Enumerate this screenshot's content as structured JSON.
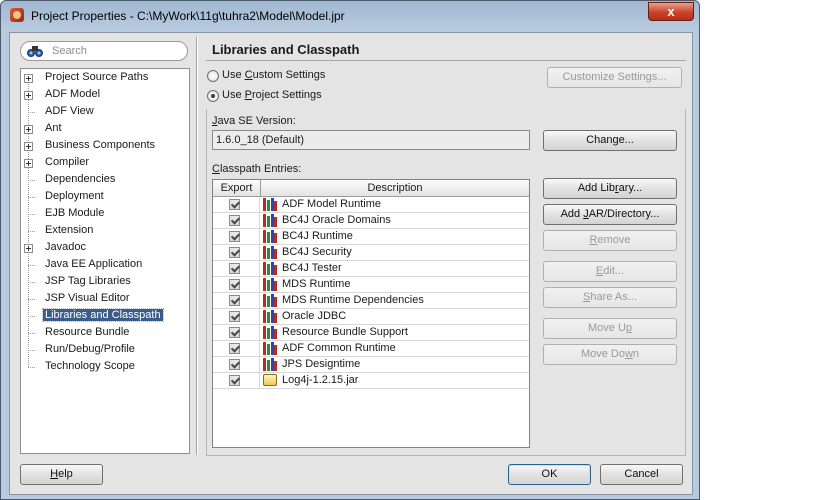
{
  "window": {
    "title": "Project Properties - C:\\MyWork\\11g\\tuhra2\\Model\\Model.jpr",
    "close_label": "x"
  },
  "search": {
    "placeholder": "Search"
  },
  "nav": {
    "items": [
      {
        "label": "Project Source Paths",
        "expandable": true,
        "selected": false
      },
      {
        "label": "ADF Model",
        "expandable": true,
        "selected": false
      },
      {
        "label": "ADF View",
        "expandable": false,
        "selected": false
      },
      {
        "label": "Ant",
        "expandable": true,
        "selected": false
      },
      {
        "label": "Business Components",
        "expandable": true,
        "selected": false
      },
      {
        "label": "Compiler",
        "expandable": true,
        "selected": false
      },
      {
        "label": "Dependencies",
        "expandable": false,
        "selected": false
      },
      {
        "label": "Deployment",
        "expandable": false,
        "selected": false
      },
      {
        "label": "EJB Module",
        "expandable": false,
        "selected": false
      },
      {
        "label": "Extension",
        "expandable": false,
        "selected": false
      },
      {
        "label": "Javadoc",
        "expandable": true,
        "selected": false
      },
      {
        "label": "Java EE Application",
        "expandable": false,
        "selected": false
      },
      {
        "label": "JSP Tag Libraries",
        "expandable": false,
        "selected": false
      },
      {
        "label": "JSP Visual Editor",
        "expandable": false,
        "selected": false
      },
      {
        "label": "Libraries and Classpath",
        "expandable": false,
        "selected": true
      },
      {
        "label": "Resource Bundle",
        "expandable": false,
        "selected": false
      },
      {
        "label": "Run/Debug/Profile",
        "expandable": false,
        "selected": false
      },
      {
        "label": "Technology Scope",
        "expandable": false,
        "selected": false
      }
    ]
  },
  "page": {
    "header": "Libraries and Classpath",
    "radio_custom": {
      "pre": "Use ",
      "key": "C",
      "post": "ustom Settings",
      "checked": false
    },
    "radio_project": {
      "pre": "Use ",
      "key": "P",
      "post": "roject Settings",
      "checked": true
    },
    "customize_button": "Customize Settings...",
    "java_se_label": {
      "key": "J",
      "post": "ava SE Version:"
    },
    "java_se_value": "1.6.0_18 (Default)",
    "change_button": {
      "pre": "Chan",
      "key": "g",
      "post": "e..."
    },
    "classpath_label": {
      "key": "C",
      "post": "lasspath Entries:"
    },
    "table": {
      "headers": {
        "export": "Export",
        "description": "Description"
      },
      "rows": [
        {
          "export": true,
          "description": "ADF Model Runtime",
          "icon": "library-icon"
        },
        {
          "export": true,
          "description": "BC4J Oracle Domains",
          "icon": "library-icon"
        },
        {
          "export": true,
          "description": "BC4J Runtime",
          "icon": "library-icon"
        },
        {
          "export": true,
          "description": "BC4J Security",
          "icon": "library-icon"
        },
        {
          "export": true,
          "description": "BC4J Tester",
          "icon": "library-icon"
        },
        {
          "export": true,
          "description": "MDS Runtime",
          "icon": "library-icon"
        },
        {
          "export": true,
          "description": "MDS Runtime Dependencies",
          "icon": "library-icon"
        },
        {
          "export": true,
          "description": "Oracle JDBC",
          "icon": "library-icon"
        },
        {
          "export": true,
          "description": "Resource Bundle Support",
          "icon": "library-icon"
        },
        {
          "export": true,
          "description": "ADF Common Runtime",
          "icon": "library-icon"
        },
        {
          "export": true,
          "description": "JPS Designtime",
          "icon": "library-icon"
        },
        {
          "export": true,
          "description": "Log4j-1.2.15.jar",
          "icon": "jar-icon"
        }
      ]
    },
    "buttons": {
      "add_library": {
        "pre": "Add Lib",
        "key": "r",
        "post": "ary..."
      },
      "add_jar": {
        "pre": "Add ",
        "key": "J",
        "post": "AR/Directory..."
      },
      "remove": {
        "pre": "",
        "key": "R",
        "post": "emove"
      },
      "edit": {
        "pre": "",
        "key": "E",
        "post": "dit..."
      },
      "share_as": {
        "pre": "",
        "key": "S",
        "post": "hare As..."
      },
      "move_up": {
        "pre": "Move U",
        "key": "p",
        "post": ""
      },
      "move_down": {
        "pre": "Move Do",
        "key": "w",
        "post": "n"
      }
    }
  },
  "footer": {
    "help": {
      "pre": "",
      "key": "H",
      "post": "elp"
    },
    "ok": "OK",
    "cancel": "Cancel"
  },
  "colors": {
    "selection": "#3a5c8a",
    "title_gradient": "#b7cadf",
    "close_button": "#c7442a",
    "library_icon_bars": [
      "#b52a2a",
      "#2f8a2f",
      "#1f4fae"
    ]
  }
}
